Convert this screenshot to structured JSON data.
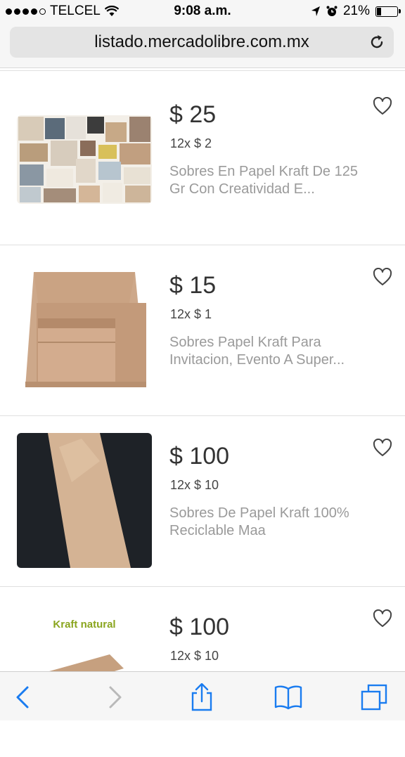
{
  "status": {
    "carrier": "TELCEL",
    "time": "9:08 a.m.",
    "battery": "21%",
    "battery_level": 0.21
  },
  "browser": {
    "url": "listado.mercadolibre.com.mx"
  },
  "items": [
    {
      "price": "$ 25",
      "installments": "12x $ 2",
      "title_line1": "Sobres En Papel Kraft De 125",
      "title_line2": "Gr Con Creatividad E..."
    },
    {
      "price": "$ 15",
      "installments": "12x $ 1",
      "title_line1": "Sobres Papel Kraft Para",
      "title_line2": "Invitacion, Evento A Super..."
    },
    {
      "price": "$ 100",
      "installments": "12x $ 10",
      "title_line1": "Sobres De Papel Kraft 100%",
      "title_line2": "Reciclable Maa"
    },
    {
      "price": "$ 100",
      "installments": "12x $ 10",
      "title_line1": "",
      "title_line2": "",
      "image_text": "Kraft natural"
    }
  ],
  "toolbar": {
    "icons": [
      "back-icon",
      "forward-icon",
      "share-icon",
      "bookmarks-icon",
      "tabs-icon"
    ]
  },
  "colors": {
    "accent": "#1a7cf0",
    "kraft": "#c9a27e",
    "kraft_text": "#8aa51e"
  }
}
